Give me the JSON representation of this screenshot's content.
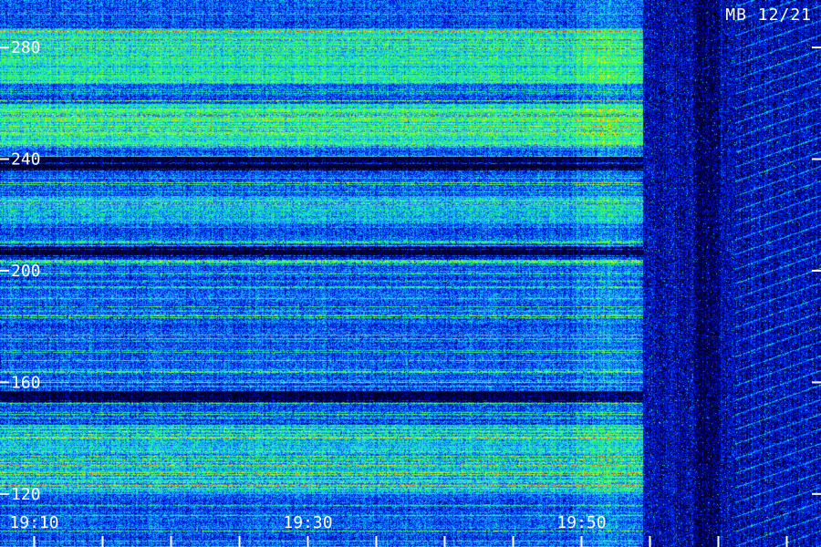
{
  "chart_data": {
    "type": "heatmap",
    "title": "",
    "station_label": "MB 12/21",
    "xlabel": "",
    "ylabel": "",
    "x_ticks": [
      {
        "label": "19:10",
        "minute": 10
      },
      {
        "label": "19:30",
        "minute": 30
      },
      {
        "label": "19:50",
        "minute": 50
      }
    ],
    "x_range_minutes": [
      7.5,
      67.5
    ],
    "x_minor_tick_interval_minutes": 5,
    "y_ticks": [
      120,
      160,
      200,
      240,
      280
    ],
    "y_range": [
      101,
      297
    ],
    "colormap": [
      "#000018",
      "#00009a",
      "#0030ff",
      "#10a0ff",
      "#20f0c0",
      "#40ff30",
      "#f0ff10",
      "#ff2000"
    ],
    "activity_end_minute": 54.5,
    "quiet_bands": [
      {
        "from": 236,
        "to": 241,
        "level": "low"
      },
      {
        "from": 153,
        "to": 157,
        "level": "low"
      },
      {
        "from": 205,
        "to": 209,
        "level": "low"
      }
    ],
    "strong_bands": [
      {
        "from": 245,
        "to": 260,
        "level": "high"
      },
      {
        "from": 267,
        "to": 287,
        "level": "high"
      },
      {
        "from": 217,
        "to": 227,
        "level": "medium"
      },
      {
        "from": 120,
        "to": 145,
        "level": "medium"
      }
    ]
  }
}
